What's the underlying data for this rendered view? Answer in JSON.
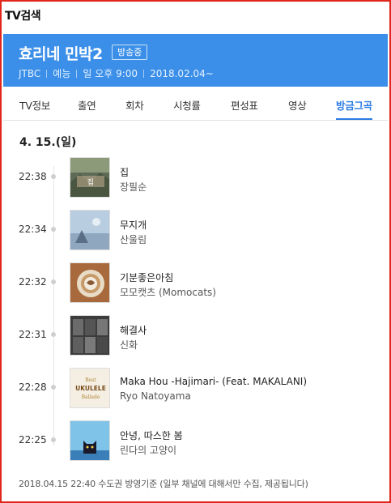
{
  "page": {
    "title": "TV검색"
  },
  "program": {
    "title": "효리네 민박2",
    "badge": "방송중",
    "network": "JTBC",
    "genre": "예능",
    "schedule": "일 오후 9:00",
    "period": "2018.02.04~"
  },
  "tabs": [
    "TV정보",
    "출연",
    "회차",
    "시청률",
    "편성표",
    "영상",
    "방금그곡"
  ],
  "active_tab": "방금그곡",
  "date": "4. 15.(일)",
  "songs": [
    {
      "time": "22:38",
      "title": "집",
      "artist": "장필순",
      "thumb": "album-art-1"
    },
    {
      "time": "22:34",
      "title": "무지개",
      "artist": "산울림",
      "thumb": "album-art-2"
    },
    {
      "time": "22:32",
      "title": "기분좋은아침",
      "artist": "모모캣츠 (Momocats)",
      "thumb": "album-art-3"
    },
    {
      "time": "22:31",
      "title": "해결사",
      "artist": "신화",
      "thumb": "album-art-4"
    },
    {
      "time": "22:28",
      "title": "Maka Hou -Hajimari- (Feat. MAKALANI)",
      "artist": "Ryo Natoyama",
      "thumb": "album-art-5"
    },
    {
      "time": "22:25",
      "title": "안녕, 따스한 봄",
      "artist": "린다의 고양이",
      "thumb": "album-art-6"
    }
  ],
  "footer": "2018.04.15 22:40 수도권 방영기준 (일부 채널에 대해서만 수집, 제공됩니다)",
  "colors": {
    "header_bg": "#3b8fe8",
    "active_tab": "#2b7be4",
    "frame": "#e1261c"
  }
}
